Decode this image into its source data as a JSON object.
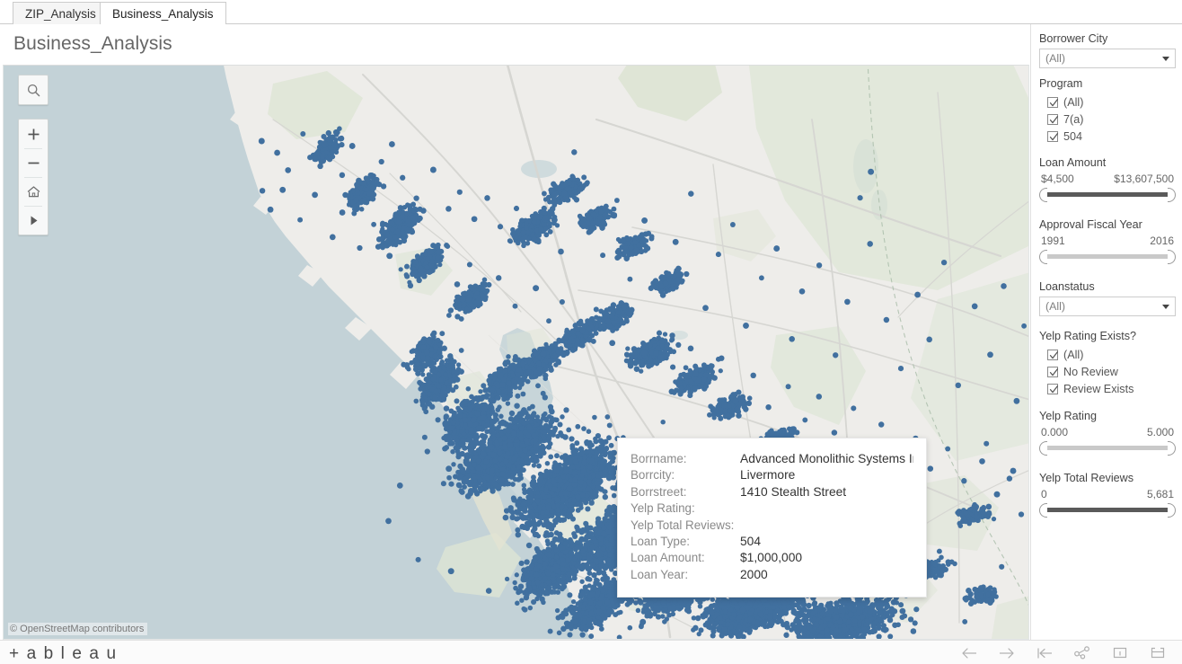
{
  "tabs": [
    {
      "label": "ZIP_Analysis",
      "active": false
    },
    {
      "label": "Business_Analysis",
      "active": true
    }
  ],
  "dashboard": {
    "title": "Business_Analysis"
  },
  "map": {
    "attribution": "© OpenStreetMap contributors",
    "ocean_color": "#c3d2d7",
    "land_color": "#eeedea",
    "green_color": "#dde5d5",
    "mark_color": "#41709f",
    "tools": [
      {
        "name": "search-icon",
        "title": "Search"
      },
      {
        "name": "zoom-in-icon",
        "title": "Zoom In"
      },
      {
        "name": "zoom-out-icon",
        "title": "Zoom Out"
      },
      {
        "name": "home-icon",
        "title": "Zoom Home"
      },
      {
        "name": "play-icon",
        "title": "Show Toolbar"
      }
    ]
  },
  "tooltip": {
    "rows": [
      {
        "key": "Borrname:",
        "value": "Advanced Monolithic Systems In"
      },
      {
        "key": "Borrcity:",
        "value": "Livermore"
      },
      {
        "key": "Borrstreet:",
        "value": "1410 Stealth Street"
      },
      {
        "key": "Yelp Rating:",
        "value": ""
      },
      {
        "key": "Yelp Total Reviews:",
        "value": ""
      },
      {
        "key": "Loan Type:",
        "value": "504"
      },
      {
        "key": "Loan Amount:",
        "value": "$1,000,000"
      },
      {
        "key": "Loan Year:",
        "value": "2000"
      }
    ]
  },
  "filters": {
    "borrower_city": {
      "title": "Borrower City",
      "value": "(All)"
    },
    "program": {
      "title": "Program",
      "options": [
        {
          "label": "(All)",
          "checked": true
        },
        {
          "label": "7(a)",
          "checked": true
        },
        {
          "label": "504",
          "checked": true
        }
      ]
    },
    "loan_amount": {
      "title": "Loan Amount",
      "min": "$4,500",
      "max": "$13,607,500",
      "filled": true
    },
    "approval_fiscal_year": {
      "title": "Approval Fiscal Year",
      "min": "1991",
      "max": "2016",
      "filled": false
    },
    "loanstatus": {
      "title": "Loanstatus",
      "value": "(All)"
    },
    "yelp_rating_exists": {
      "title": "Yelp Rating Exists?",
      "options": [
        {
          "label": "(All)",
          "checked": true
        },
        {
          "label": "No Review",
          "checked": true
        },
        {
          "label": "Review Exists",
          "checked": true
        }
      ]
    },
    "yelp_rating": {
      "title": "Yelp Rating",
      "min": "0.000",
      "max": "5.000",
      "filled": false
    },
    "yelp_total_reviews": {
      "title": "Yelp Total Reviews",
      "min": "0",
      "max": "5,681",
      "filled": true
    }
  },
  "statusbar": {
    "logo": "+ a b l e a u",
    "buttons": [
      {
        "name": "back-icon",
        "title": "Back"
      },
      {
        "name": "forward-icon",
        "title": "Forward"
      },
      {
        "name": "revert-icon",
        "title": "Revert"
      },
      {
        "name": "share-icon",
        "title": "Share"
      },
      {
        "name": "device-layout-icon",
        "title": "Device Layout"
      },
      {
        "name": "fullscreen-icon",
        "title": "Full Screen"
      }
    ]
  }
}
